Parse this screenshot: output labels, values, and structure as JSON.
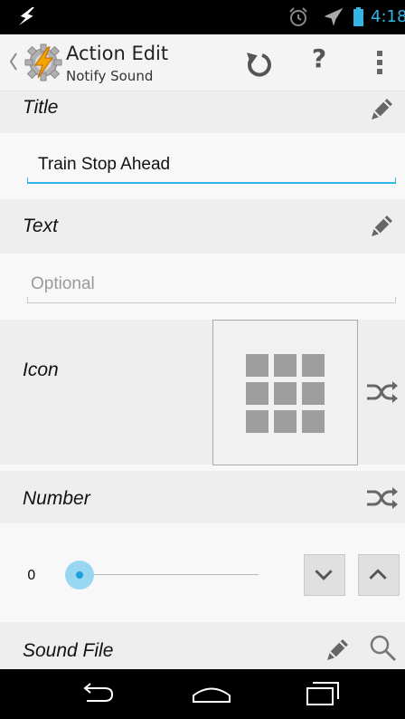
{
  "status_bar": {
    "time": "4:18",
    "icons": [
      "flash-icon",
      "alarm-clock-icon",
      "airplane-mode-icon",
      "battery-icon"
    ],
    "accent_color": "#33b5e5"
  },
  "action_bar": {
    "title": "Action Edit",
    "subtitle": "Notify Sound",
    "icons": [
      "up-chevron-icon",
      "tasker-app-icon",
      "undo-icon",
      "help-icon",
      "overflow-menu-icon"
    ],
    "help_glyph": "?"
  },
  "title_section": {
    "label": "Title",
    "value": "Train Stop Ahead"
  },
  "text_section": {
    "label": "Text",
    "placeholder": "Optional"
  },
  "icon_section": {
    "label": "Icon"
  },
  "number_section": {
    "label": "Number",
    "slider_value": "0",
    "slider_fraction": 0
  },
  "sound_file_section": {
    "label": "Sound File"
  },
  "colors": {
    "focused_underline": "#33b5e5",
    "section_bg": "#eeeeee",
    "slider_knob": "#1e9edb"
  }
}
